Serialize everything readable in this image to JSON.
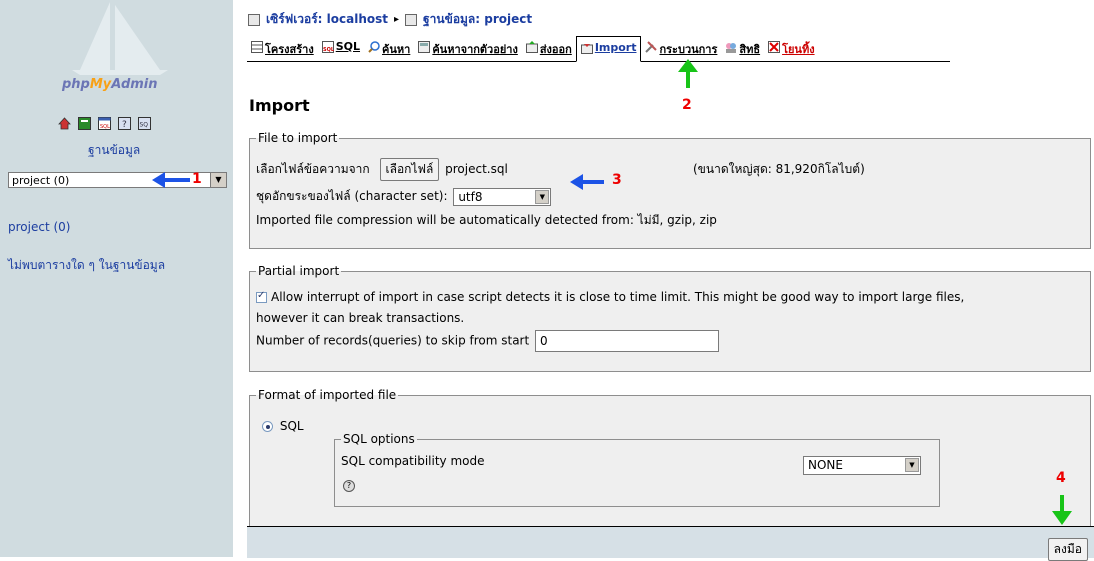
{
  "sidebar": {
    "logo": {
      "php": "php",
      "my": "My",
      "admin": "Admin"
    },
    "icons": [
      "home-icon",
      "exit-icon",
      "sql-icon",
      "help-icon",
      "docs-icon"
    ],
    "database_label": "ฐานข้อมูล",
    "database_select_value": "project (0)",
    "database_link": "project (0)",
    "no_tables_text": "ไม่พบตารางใด ๆ ในฐานข้อมูล"
  },
  "breadcrumb": {
    "server": "เซิร์ฟเวอร์: localhost",
    "separator": "▸",
    "database": "ฐานข้อมูล: project"
  },
  "tabs": [
    {
      "label": "โครงสร้าง",
      "icon": "structure-icon"
    },
    {
      "label": "SQL",
      "icon": "sql-icon"
    },
    {
      "label": "ค้นหา",
      "icon": "search-icon"
    },
    {
      "label": "ค้นหาจากตัวอย่าง",
      "icon": "query-icon"
    },
    {
      "label": "ส่งออก",
      "icon": "export-icon"
    },
    {
      "label": "Import",
      "icon": "import-icon",
      "active": true
    },
    {
      "label": "กระบวนการ",
      "icon": "operations-icon"
    },
    {
      "label": "สิทธิ",
      "icon": "privileges-icon"
    },
    {
      "label": "โยนทิ้ง",
      "icon": "drop-icon"
    }
  ],
  "page_title": "Import",
  "file_to_import": {
    "legend": "File to import",
    "choose_file_label": "เลือกไฟล์ข้อความจาก",
    "choose_file_button": "เลือกไฟล์",
    "file_name": "project.sql",
    "max_size": "(ขนาดใหญ่สุด: 81,920กิโลไบต์)",
    "charset_label": "ชุดอักขระของไฟล์ (character set):",
    "charset_value": "utf8",
    "compression_text": "Imported file compression will be automatically detected from: ไม่มี, gzip, zip"
  },
  "partial_import": {
    "legend": "Partial import",
    "allow_interrupt_line1": "Allow interrupt of import in case script detects it is close to time limit. This might be good way to import large files,",
    "allow_interrupt_line2": "however it can break transactions.",
    "allow_interrupt_checked": true,
    "skip_label": "Number of records(queries) to skip from start",
    "skip_value": "0"
  },
  "format": {
    "legend": "Format of imported file",
    "sql_radio_label": "SQL",
    "sql_options_legend": "SQL options",
    "compat_label": "SQL compatibility mode",
    "compat_value": "NONE"
  },
  "go_button": "ลงมือ",
  "annotations": {
    "n1": "1",
    "n2": "2",
    "n3": "3",
    "n4": "4"
  },
  "colors": {
    "sidebar_bg": "#D0DCE0",
    "fieldset_bg": "#EFEFEF",
    "link": "#1B3DA0",
    "arrow_blue": "#1C53E6",
    "arrow_green": "#18C418",
    "annotation_red": "#E00000"
  }
}
